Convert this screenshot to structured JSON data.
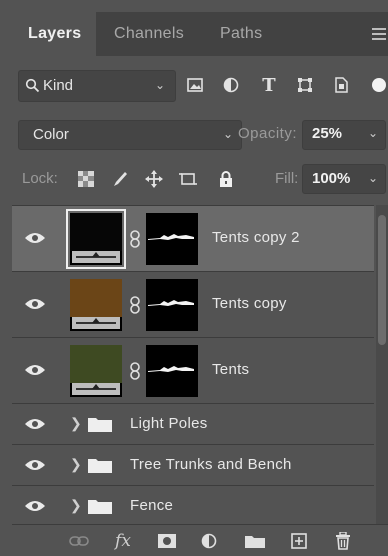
{
  "tabs": [
    "Layers",
    "Channels",
    "Paths"
  ],
  "filter": {
    "label": "Kind"
  },
  "blend": {
    "mode": "Color",
    "opacity_label": "Opacity:",
    "opacity": "25%"
  },
  "lock": {
    "label": "Lock:",
    "fill_label": "Fill:",
    "fill": "100%"
  },
  "layers": [
    {
      "name": "Tents copy 2",
      "color": "#060606",
      "selected": true
    },
    {
      "name": "Tents copy",
      "color": "#6b4517",
      "selected": false
    },
    {
      "name": "Tents",
      "color": "#3e4a22",
      "selected": false
    }
  ],
  "groups": [
    {
      "name": "Light Poles"
    },
    {
      "name": "Tree Trunks and Bench"
    },
    {
      "name": "Fence"
    }
  ]
}
